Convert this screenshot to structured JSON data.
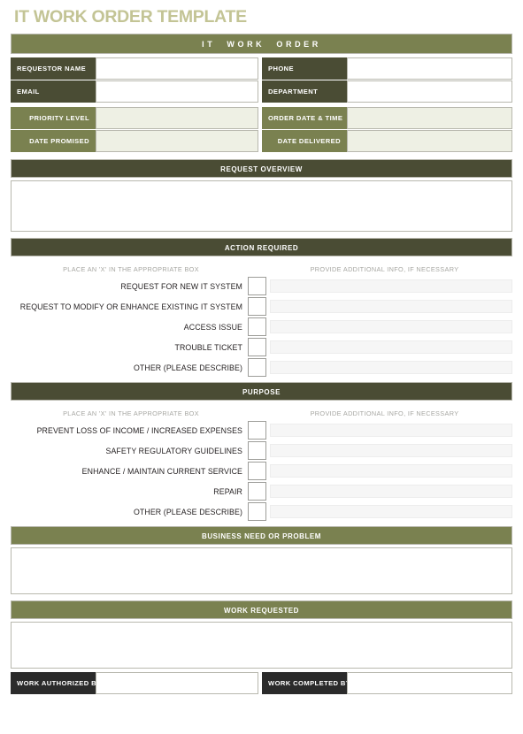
{
  "document": {
    "title": "IT WORK ORDER TEMPLATE",
    "banner": "IT  WORK  ORDER"
  },
  "colors": {
    "title": "#c3c495",
    "dark_olive": "#4a4c34",
    "mid_olive": "#7a8150",
    "tint_field": "#eef0e4",
    "charcoal": "#2b2b2b",
    "border": "#b8b8ae"
  },
  "info": {
    "rows": [
      {
        "left_label": "REQUESTOR NAME",
        "left_value": "",
        "right_label": "PHONE",
        "right_value": ""
      },
      {
        "left_label": "EMAIL",
        "left_value": "",
        "right_label": "DEPARTMENT",
        "right_value": ""
      }
    ],
    "rows_tinted": [
      {
        "left_label": "PRIORITY LEVEL",
        "left_value": "",
        "right_label": "ORDER DATE & TIME",
        "right_value": ""
      },
      {
        "left_label": "DATE PROMISED",
        "left_value": "",
        "right_label": "DATE DELIVERED",
        "right_value": ""
      }
    ]
  },
  "sections": {
    "request_overview": {
      "heading": "REQUEST OVERVIEW",
      "value": ""
    },
    "action_required": {
      "heading": "ACTION REQUIRED",
      "instruction_left": "PLACE AN 'X' IN THE APPROPRIATE BOX",
      "instruction_right": "PROVIDE ADDITIONAL INFO, IF NECESSARY",
      "items": [
        {
          "label": "REQUEST FOR NEW IT SYSTEM",
          "checked": "",
          "note": ""
        },
        {
          "label": "REQUEST TO MODIFY OR ENHANCE EXISTING IT SYSTEM",
          "checked": "",
          "note": ""
        },
        {
          "label": "ACCESS ISSUE",
          "checked": "",
          "note": ""
        },
        {
          "label": "TROUBLE TICKET",
          "checked": "",
          "note": ""
        },
        {
          "label": "OTHER (PLEASE DESCRIBE)",
          "checked": "",
          "note": ""
        }
      ]
    },
    "purpose": {
      "heading": "PURPOSE",
      "instruction_left": "PLACE AN 'X' IN THE APPROPRIATE BOX",
      "instruction_right": "PROVIDE ADDITIONAL INFO, IF NECESSARY",
      "items": [
        {
          "label": "PREVENT LOSS OF INCOME / INCREASED EXPENSES",
          "checked": "",
          "note": ""
        },
        {
          "label": "SAFETY REGULATORY GUIDELINES",
          "checked": "",
          "note": ""
        },
        {
          "label": "ENHANCE / MAINTAIN CURRENT SERVICE",
          "checked": "",
          "note": ""
        },
        {
          "label": "REPAIR",
          "checked": "",
          "note": ""
        },
        {
          "label": "OTHER (PLEASE DESCRIBE)",
          "checked": "",
          "note": ""
        }
      ]
    },
    "business_need": {
      "heading": "BUSINESS NEED OR PROBLEM",
      "value": ""
    },
    "work_requested": {
      "heading": "WORK REQUESTED",
      "value": ""
    }
  },
  "signatures": {
    "authorized_label": "WORK AUTHORIZED BY",
    "authorized_value": "",
    "completed_label": "WORK COMPLETED BY",
    "completed_value": ""
  }
}
